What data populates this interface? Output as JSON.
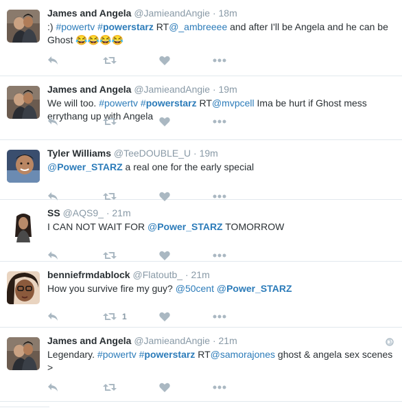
{
  "tweets": [
    {
      "name": "James and Angela",
      "handle": "@JamieandAngie",
      "separator": "·",
      "time": "18m",
      "parts": [
        {
          "t": "text",
          "v": ":) "
        },
        {
          "t": "hash",
          "v": "#powertv"
        },
        {
          "t": "text",
          "v": " "
        },
        {
          "t": "hashb",
          "pre": "#",
          "v": "powerstarz"
        },
        {
          "t": "text",
          "v": " RT"
        },
        {
          "t": "mention",
          "v": "@_ambreeee"
        },
        {
          "t": "text",
          "v": "  and after I'll be Angela and he can be Ghost "
        },
        {
          "t": "emoji",
          "v": "😂😂😂😂"
        }
      ],
      "retweet_count": "",
      "avatar": "couple"
    },
    {
      "name": "James and Angela",
      "handle": "@JamieandAngie",
      "separator": "·",
      "time": "19m",
      "parts": [
        {
          "t": "text",
          "v": "We will too. "
        },
        {
          "t": "hash",
          "v": "#powertv"
        },
        {
          "t": "text",
          "v": " "
        },
        {
          "t": "hashb",
          "pre": "#",
          "v": "powerstarz"
        },
        {
          "t": "text",
          "v": " RT"
        },
        {
          "t": "mention",
          "v": "@mvpcell"
        },
        {
          "t": "text",
          "v": "  Ima be hurt if Ghost mess errythang up with Angela"
        }
      ],
      "retweet_count": "",
      "avatar": "couple"
    },
    {
      "name": "Tyler Williams",
      "handle": "@TeeDOUBLE_U",
      "separator": "·",
      "time": "19m",
      "parts": [
        {
          "t": "mentionb",
          "pre": "@",
          "v": "Power_STARZ"
        },
        {
          "t": "text",
          "v": " a real one for the early special"
        }
      ],
      "retweet_count": "",
      "avatar": "tyler"
    },
    {
      "name": "SS",
      "handle": "@AQS9_",
      "separator": "·",
      "time": "21m",
      "parts": [
        {
          "t": "text",
          "v": "I CAN NOT WAIT FOR "
        },
        {
          "t": "mentionb",
          "pre": "@",
          "v": "Power_STARZ"
        },
        {
          "t": "text",
          "v": " TOMORROW"
        }
      ],
      "retweet_count": "",
      "avatar": "ss"
    },
    {
      "name": "benniefrmdablock",
      "handle": "@Flatoutb_",
      "separator": "·",
      "time": "21m",
      "parts": [
        {
          "t": "text",
          "v": "How you survive fire my guy? "
        },
        {
          "t": "mention",
          "v": "@50cent"
        },
        {
          "t": "text",
          "v": " "
        },
        {
          "t": "mentionb",
          "pre": "@",
          "v": "Power_STARZ"
        }
      ],
      "retweet_count": "1",
      "avatar": "bennie"
    },
    {
      "name": "James and Angela",
      "handle": "@JamieandAngie",
      "separator": "·",
      "time": "21m",
      "parts": [
        {
          "t": "text",
          "v": "Legendary. "
        },
        {
          "t": "hash",
          "v": "#powertv"
        },
        {
          "t": "text",
          "v": " "
        },
        {
          "t": "hashb",
          "pre": "#",
          "v": "powerstarz"
        },
        {
          "t": "text",
          "v": " RT"
        },
        {
          "t": "mention",
          "v": "@samorajones"
        },
        {
          "t": "text",
          "v": "  ghost & angela sex scenes >"
        }
      ],
      "retweet_count": "",
      "avatar": "couple",
      "show_globe": true
    }
  ],
  "icons": {
    "reply": "reply-icon",
    "retweet": "retweet-icon",
    "like": "heart-icon",
    "more": "more-icon",
    "geo": "globe-icon"
  },
  "colors": {
    "link": "#2b7bb9",
    "muted": "#8899a6",
    "text": "#292f33",
    "icon": "#aab8c2",
    "divider": "#e1e8ed"
  }
}
